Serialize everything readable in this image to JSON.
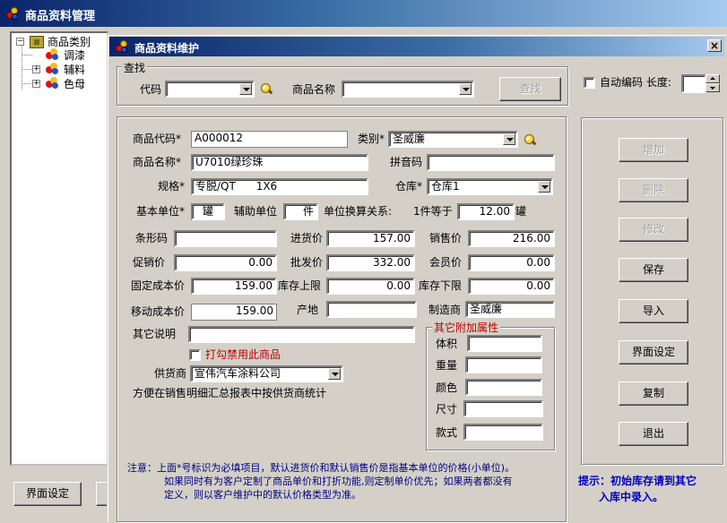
{
  "app": {
    "title": "商品资料管理"
  },
  "tree": {
    "root_label": "商品类别",
    "items": [
      {
        "label": "调漆"
      },
      {
        "label": "辅料"
      },
      {
        "label": "色母"
      }
    ]
  },
  "bottom_left": {
    "button_label": "界面设定"
  },
  "dialog": {
    "title": "商品资料维护",
    "close_label": "×",
    "search": {
      "group_label": "查找",
      "code_label": "代码",
      "code_value": "",
      "name_label": "商品名称",
      "name_value": "",
      "find_button": "查找"
    },
    "auto_code": {
      "label": "自动编码 长度:",
      "value": ""
    },
    "form": {
      "code_label": "商品代码*",
      "code_value": "A000012",
      "category_label": "类别*",
      "category_value": "圣威廉",
      "name_label": "商品名称*",
      "name_value": "U7010绿珍珠",
      "pinyin_label": "拼音码",
      "pinyin_value": "",
      "spec_label": "规格*",
      "spec_value": "专脱/QT      1X6",
      "warehouse_label": "仓库*",
      "warehouse_value": "仓库1",
      "base_unit_label": "基本单位*",
      "base_unit_value": "罐",
      "aux_unit_label": "辅助单位",
      "aux_unit_value": "件",
      "conversion_label": "单位换算关系:",
      "conversion_prefix": "1件等于",
      "conversion_value": "12.00",
      "conversion_unit": "罐",
      "barcode_label": "条形码",
      "barcode_value": "",
      "purchase_price_label": "进货价",
      "purchase_price_value": "157.00",
      "sale_price_label": "销售价",
      "sale_price_value": "216.00",
      "promo_price_label": "促销价",
      "promo_price_value": "0.00",
      "wholesale_price_label": "批发价",
      "wholesale_price_value": "332.00",
      "member_price_label": "会员价",
      "member_price_value": "0.00",
      "fixed_cost_label": "固定成本价",
      "fixed_cost_value": "159.00",
      "stock_max_label": "库存上限",
      "stock_max_value": "0.00",
      "stock_min_label": "库存下限",
      "stock_min_value": "0.00",
      "moving_cost_label": "移动成本价",
      "moving_cost_value": "159.00",
      "origin_label": "产地",
      "origin_value": "",
      "manufacturer_label": "制造商",
      "manufacturer_value": "圣威廉",
      "other_desc_label": "其它说明",
      "other_desc_value": "",
      "disable_label": "打勾禁用此商品",
      "supplier_label": "供货商",
      "supplier_value": "宣伟汽车涂料公司",
      "supplier_note": "方便在销售明细汇总报表中按供货商统计"
    },
    "extra": {
      "group_label": "其它附加属性",
      "volume_label": "体积",
      "weight_label": "重量",
      "color_label": "颜色",
      "size_label": "尺寸",
      "style_label": "款式"
    },
    "note": {
      "line1": "注意：上面*号标识为必填项目，默认进货价和默认销售价是指基本单位的价格(小单位)。",
      "line2": "如果同时有为客户定制了商品单价和打折功能,则定制单价优先；如果两者都没有",
      "line3": "定义，则以客户维护中的默认价格类型为准。"
    },
    "buttons": {
      "add": "增加",
      "delete": "删除",
      "edit": "修改",
      "save": "保存",
      "import": "导入",
      "ui_settings": "界面设定",
      "copy": "复制",
      "exit": "退出"
    },
    "hint": {
      "line1": "提示：初始库存请到其它",
      "line2": "入库中录入。"
    }
  }
}
